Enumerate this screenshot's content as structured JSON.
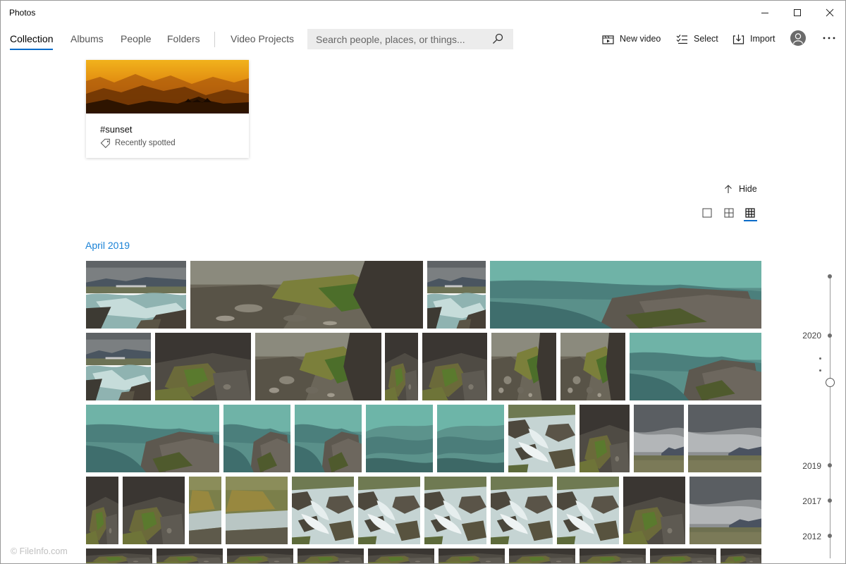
{
  "window": {
    "title": "Photos"
  },
  "nav": {
    "tabs": [
      {
        "label": "Collection",
        "active": true
      },
      {
        "label": "Albums"
      },
      {
        "label": "People"
      },
      {
        "label": "Folders"
      },
      {
        "label": "Video Projects"
      }
    ],
    "search_placeholder": "Search people, places, or things...",
    "new_video_label": "New video",
    "select_label": "Select",
    "import_label": "Import"
  },
  "tag_card": {
    "title": "#sunset",
    "subtitle": "Recently spotted"
  },
  "view": {
    "hide_label": "Hide",
    "selected_view": "small-tiles"
  },
  "gallery": {
    "month_label": "April 2019",
    "tiles": [
      "river-bridge",
      "rocks-grass-closeup",
      "river-bridge",
      "teal-water-rocks",
      "river-bridge",
      "moss-rock",
      "rocks-grass-closeup",
      "moss-rock",
      "moss-rock",
      "rocks-grass-closeup",
      "rocks-grass-closeup",
      "teal-water-rocks",
      "teal-water-rocks",
      "teal-water-rocks",
      "teal-water-rocks",
      "teal-water-blur",
      "teal-water-blur",
      "cascade",
      "moss-rock",
      "cloudy-landscape",
      "cloudy-landscape",
      "moss-rock",
      "moss-rock",
      "grass-bank",
      "grass-bank",
      "cascade",
      "cascade",
      "cascade",
      "cascade",
      "cascade",
      "moss-rock",
      "cloudy-landscape"
    ]
  },
  "timeline": {
    "years": [
      "2020",
      "2019",
      "2017",
      "2012"
    ]
  },
  "watermark": "© FileInfo.com",
  "colors": {
    "accent": "#0a6bc9",
    "month_label": "#1a82d6",
    "search_bg": "#ececec"
  }
}
